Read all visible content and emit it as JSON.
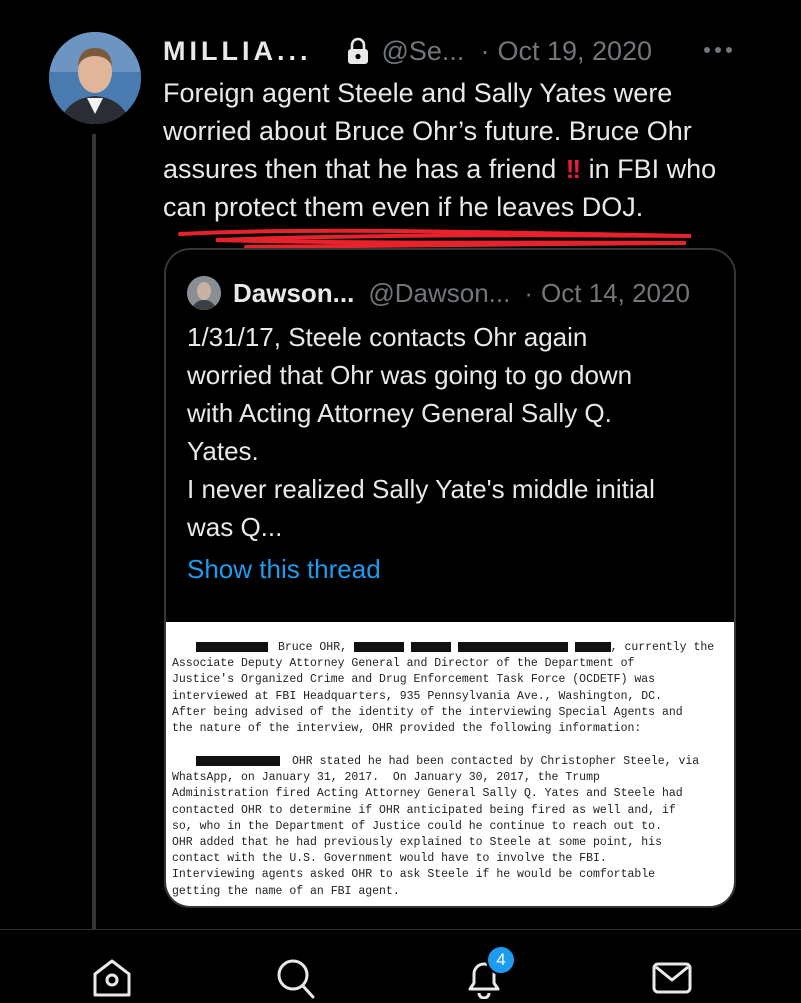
{
  "tweet": {
    "author_name": "MILLIA...",
    "handle": "@Se...",
    "separator": "·",
    "date": "Oct 19, 2020",
    "text_before_emoji": "Foreign agent Steele and Sally Yates were worried about Bruce Ohr’s future. Bruce Ohr assures then that he has a friend",
    "emoji": "‼️",
    "text_after_emoji": "in FBI who can protect them even if he leaves DOJ.",
    "lock_icon": "lock-icon",
    "more_icon": "more-horizontal-icon",
    "annotation_color": "#e8222d"
  },
  "quote": {
    "author_name": "Dawson...",
    "handle": "@Dawson...",
    "separator": "·",
    "date": "Oct 14, 2020",
    "lines": [
      "1/31/17, Steele contacts Ohr again",
      "worried that Ohr was going to go down",
      "with Acting Attorney General Sally Q.",
      "Yates.",
      "I never realized Sally Yate's middle initial",
      "was Q..."
    ],
    "show_thread": "Show this thread",
    "link_color": "#1d9bf0"
  },
  "document": {
    "para1": [
      "Bruce OHR,",
      ", currently the",
      "Associate Deputy Attorney General and Director of the Department of",
      "Justice's Organized Crime and Drug Enforcement Task Force (OCDETF) was",
      "interviewed at FBI Headquarters, 935 Pennsylvania Ave., Washington, DC.",
      "After being advised of the identity of the interviewing Special Agents and",
      "the nature of the interview, OHR provided the following information:"
    ],
    "para2": [
      "OHR stated he had been contacted by Christopher Steele, via",
      "WhatsApp, on January 31, 2017.  On January 30, 2017, the Trump",
      "Administration fired Acting Attorney General Sally Q. Yates and Steele had",
      "contacted OHR to determine if OHR anticipated being fired as well and, if",
      "so, who in the Department of Justice could he continue to reach out to.",
      "OHR added that he had previously explained to Steele at some point, his",
      "contact with the U.S. Government would have to involve the FBI.",
      "Interviewing agents asked OHR to ask Steele if he would be comfortable",
      "getting the name of an FBI agent."
    ]
  },
  "nav": {
    "home_icon": "home-icon",
    "search_icon": "search-icon",
    "notifications_icon": "bell-icon",
    "notifications_count": "4",
    "messages_icon": "mail-icon"
  }
}
